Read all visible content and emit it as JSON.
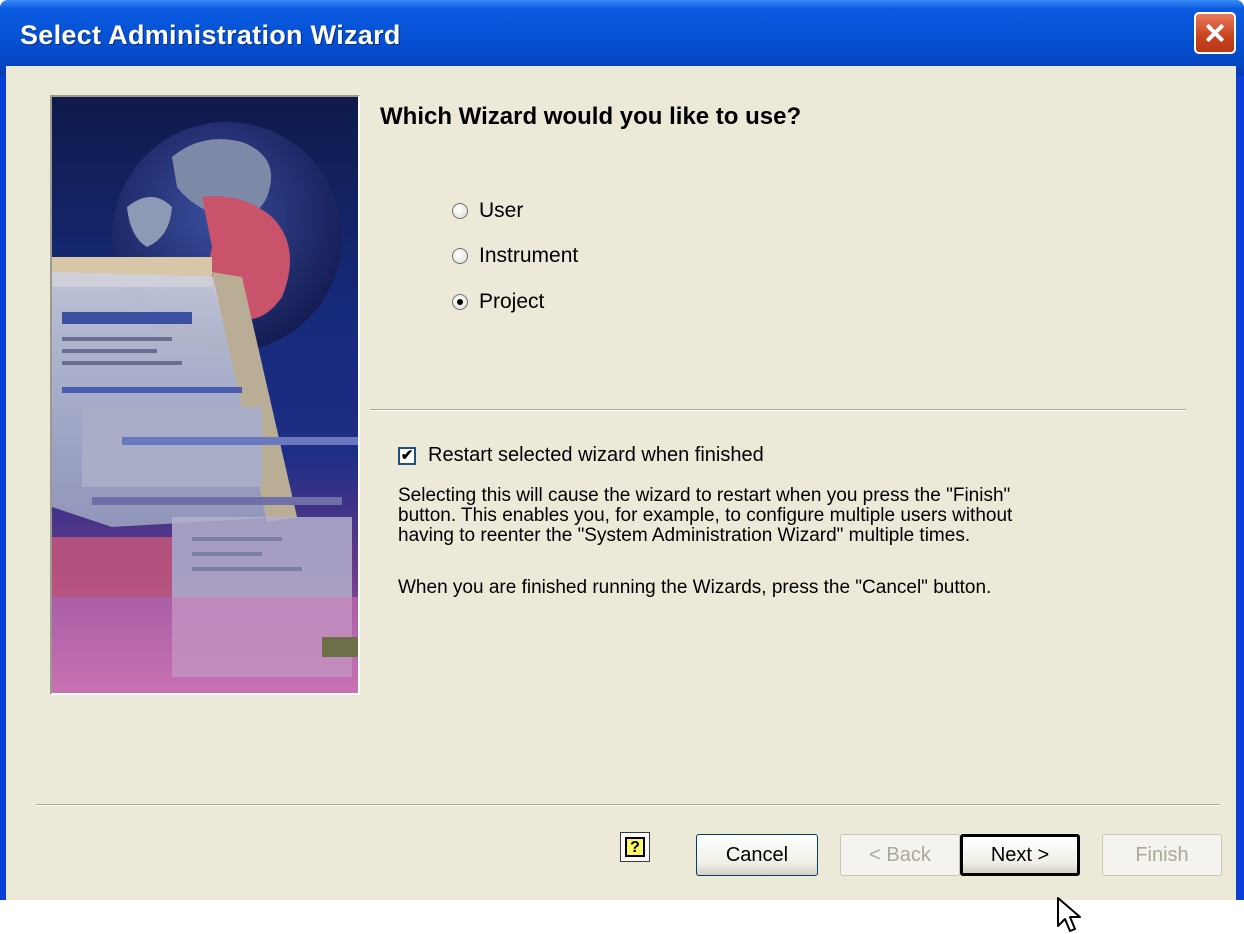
{
  "window": {
    "title": "Select Administration Wizard"
  },
  "heading": "Which Wizard would you like to use?",
  "wizard_options": [
    {
      "label": "User",
      "selected": false
    },
    {
      "label": "Instrument",
      "selected": false
    },
    {
      "label": "Project",
      "selected": true
    }
  ],
  "restart_checkbox": {
    "label": "Restart selected wizard when finished",
    "checked": true
  },
  "description": {
    "line1": "Selecting this will cause the wizard to restart when you press the \"Finish\"",
    "line2": "button.  This enables you, for example, to configure multiple users without",
    "line3": "having to reenter the \"System Administration Wizard\" multiple times.",
    "line4": "When you are finished running the Wizards, press the \"Cancel\" button."
  },
  "buttons": {
    "help": "?",
    "cancel": "Cancel",
    "back": "< Back",
    "next": "Next >",
    "finish": "Finish"
  },
  "icons": {
    "close": "close-icon",
    "help": "help-icon",
    "cursor": "mouse-pointer-icon",
    "checkmark": "✔"
  }
}
